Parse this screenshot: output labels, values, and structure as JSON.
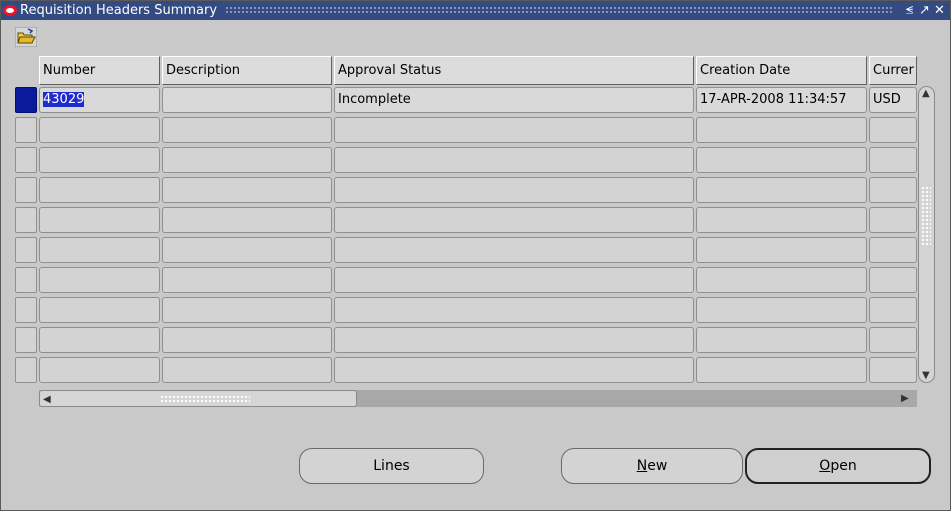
{
  "window": {
    "title": "Requisition Headers Summary",
    "controls": [
      "minimize-icon",
      "maximize-icon",
      "close-icon"
    ]
  },
  "toolbar": {
    "icon": "folder-open-icon"
  },
  "table": {
    "columns": [
      "Number",
      "Description",
      "Approval Status",
      "Creation Date",
      "Currer"
    ],
    "rows": [
      {
        "number": "43029",
        "description": "",
        "approval_status": "Incomplete",
        "creation_date": "17-APR-2008 11:34:57",
        "currency": "USD"
      }
    ],
    "empty_row_count": 9
  },
  "buttons": {
    "lines": "Lines",
    "new_prefix": "",
    "new_mnemonic": "N",
    "new_rest": "ew",
    "open_mnemonic": "O",
    "open_rest": "pen"
  },
  "colors": {
    "titlebar": "#334a82",
    "selection": "#1f2bd1",
    "background": "#c9c9c9"
  }
}
